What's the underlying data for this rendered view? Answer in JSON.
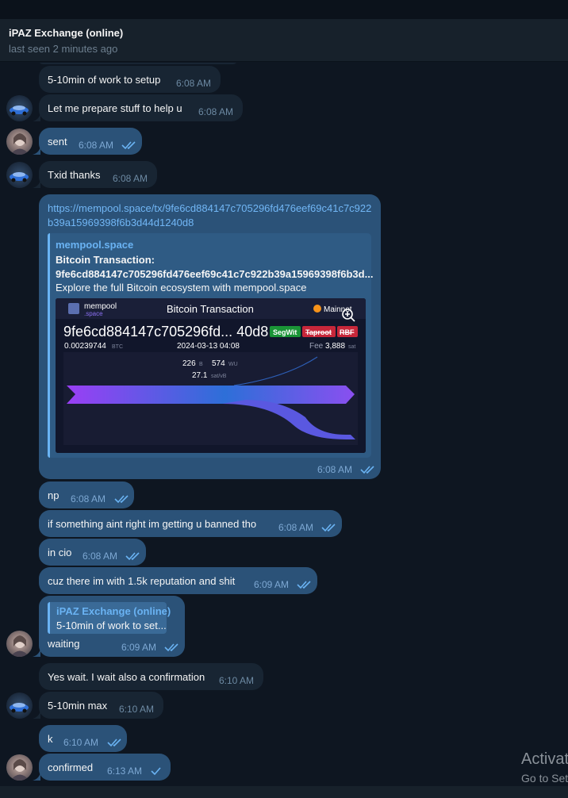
{
  "header": {
    "title": "iPAZ Exchange (online)",
    "status": "last seen 2 minutes ago"
  },
  "messages": [
    {
      "text": "5-10min of work to setup",
      "time": "6:08 AM"
    },
    {
      "text": "Let me prepare stuff to help u",
      "time": "6:08 AM"
    },
    {
      "text": "sent",
      "time": "6:08 AM"
    },
    {
      "text": "Txid thanks",
      "time": "6:08 AM"
    },
    {
      "link": "https://mempool.space/tx/9fe6cd884147c705296fd476eef69c41c7c922b39a15969398f6b3d44d1240d8",
      "time": "6:08 AM"
    },
    {
      "text": "np",
      "time": "6:08 AM"
    },
    {
      "text": "if something aint right im getting u banned tho",
      "time": "6:08 AM"
    },
    {
      "text": "in cio",
      "time": "6:08 AM"
    },
    {
      "text": "cuz there im with 1.5k reputation and shit",
      "time": "6:09 AM"
    },
    {
      "text": "waiting",
      "time": "6:09 AM"
    },
    {
      "text": "Yes wait. I wait also a confirmation",
      "time": "6:10 AM"
    },
    {
      "text": "5-10min max",
      "time": "6:10 AM"
    },
    {
      "text": "k",
      "time": "6:10 AM"
    },
    {
      "text": "confirmed",
      "time": "6:13 AM"
    }
  ],
  "preview": {
    "site": "mempool.space",
    "title": "Bitcoin Transaction: 9fe6cd884147c705296fd476eef69c41c7c922b39a15969398f6b3d...",
    "description": "Explore the full Bitcoin ecosystem with mempool.space",
    "image": {
      "logo_top": "mempool",
      "logo_bottom": ".space",
      "heading": "Bitcoin Transaction",
      "network": "Mainnet",
      "txid": "9fe6cd884147c705296fd... 40d8",
      "badges": [
        "SegWit",
        "Taproot",
        "RBF"
      ],
      "amount": "0.00239744",
      "amount_unit": "BTC",
      "date": "2024-03-13 04:08",
      "fee_label": "Fee",
      "fee": "3,888",
      "fee_unit": "sat",
      "size": "226",
      "size_unit": "B",
      "weight": "574",
      "weight_unit": "WU",
      "rate": "27.1",
      "rate_unit": "sat/vB"
    }
  },
  "reply": {
    "name": "iPAZ Exchange (online)",
    "text": "5-10min of work to set..."
  },
  "watermark": {
    "line1": "Activat",
    "line2": "Go to Set"
  },
  "colors": {
    "background": "#0e1621",
    "incoming_bubble": "#182533",
    "outgoing_bubble": "#2b5278",
    "accent": "#6ab3f3"
  }
}
